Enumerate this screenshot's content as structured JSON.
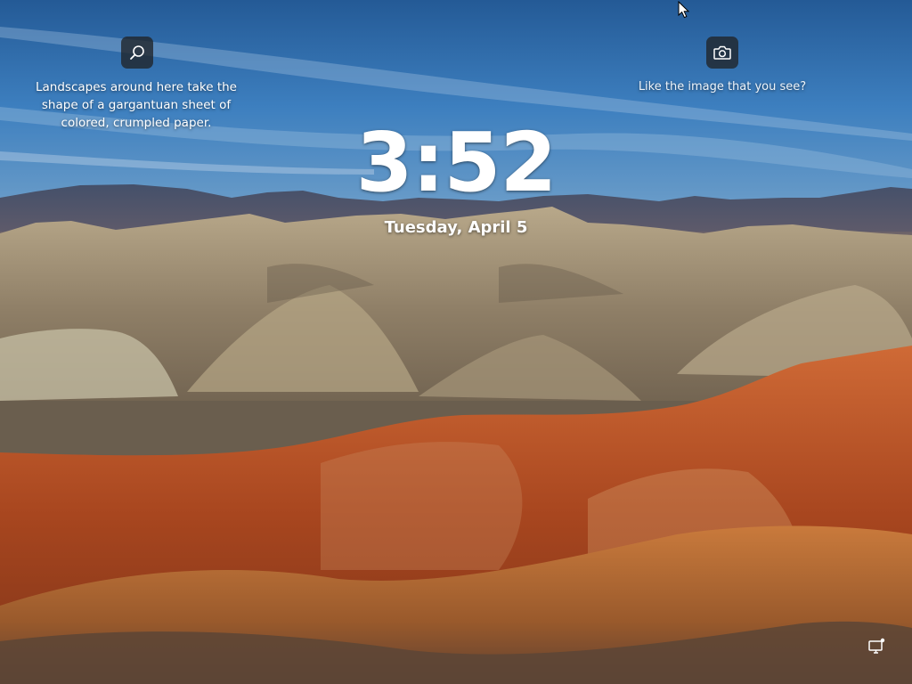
{
  "lockscreen": {
    "spotlight_caption": "Landscapes around here take the shape of a gargantuan sheet of colored, crumpled paper.",
    "like_prompt": "Like the image that you see?",
    "time": "3:52",
    "date": "Tuesday, April 5"
  },
  "icons": {
    "search": "search-icon",
    "camera": "camera-icon",
    "network": "network-icon",
    "cursor": "mouse-cursor-icon"
  },
  "colors": {
    "sky_top": "#2b5f9a",
    "sky_mid": "#4a8cc8",
    "rock_tan": "#9d8f77",
    "rock_red": "#b5552a",
    "icon_button_bg": "#202428",
    "text": "#ffffff"
  }
}
